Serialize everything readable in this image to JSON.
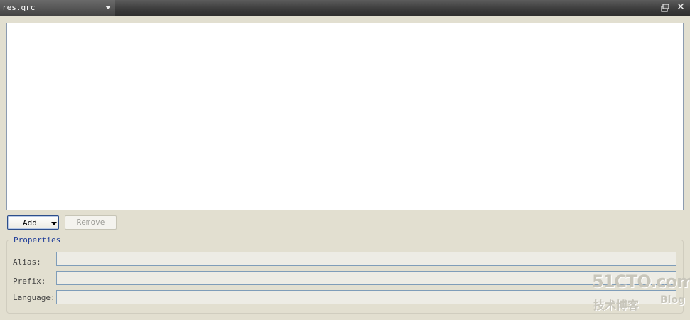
{
  "titlebar": {
    "document": "res.qrc",
    "float_icon": "float-icon",
    "close_icon": "close-icon",
    "close_glyph": "✕"
  },
  "toolbar": {
    "add_label": "Add",
    "remove_label": "Remove"
  },
  "properties": {
    "title": "Properties",
    "fields": [
      {
        "label": "Alias:",
        "value": ""
      },
      {
        "label": "Prefix:",
        "value": ""
      },
      {
        "label": "Language:",
        "value": ""
      }
    ]
  },
  "watermark": {
    "line1": "51CTO.com",
    "line2": "技术博客",
    "blog": "Blog"
  },
  "colors": {
    "window_bg": "#e2dfd0",
    "titlebar": "#3d3d3d",
    "accent_border": "#2d4e8a",
    "group_title": "#1f3d99"
  }
}
